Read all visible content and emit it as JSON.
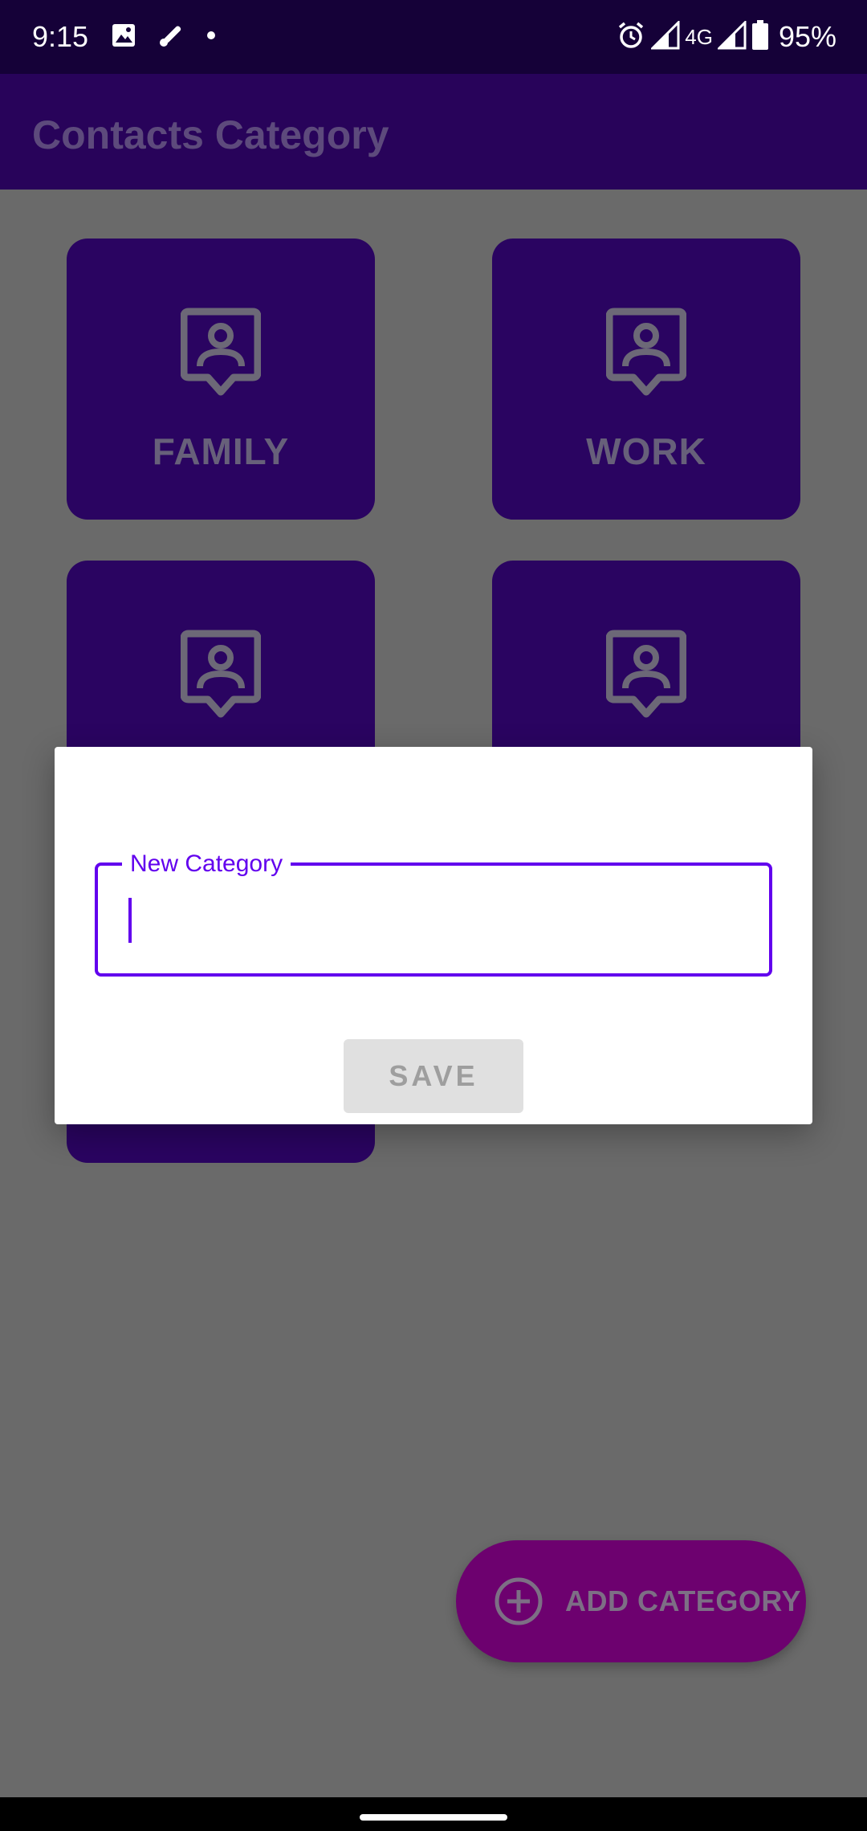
{
  "status_bar": {
    "time": "9:15",
    "network": "4G",
    "battery": "95%",
    "left_icons": [
      "image-icon",
      "brush-icon",
      "dot-icon"
    ],
    "right_icons": [
      "alarm-icon",
      "signal-icon",
      "signal-icon",
      "battery-icon"
    ]
  },
  "app_bar": {
    "title": "Contacts Category"
  },
  "categories": [
    {
      "label": "FAMILY",
      "icon": "contact-icon"
    },
    {
      "label": "WORK",
      "icon": "contact-icon"
    },
    {
      "label": "",
      "icon": "contact-icon"
    },
    {
      "label": "",
      "icon": "contact-icon"
    },
    {
      "label": "",
      "icon": ""
    }
  ],
  "dialog": {
    "field_label": "New Category",
    "field_value": "",
    "save_label": "SAVE"
  },
  "fab": {
    "label": "ADD CATEGORY",
    "icon": "add-circle-icon"
  },
  "colors": {
    "status_bar": "#150138",
    "app_bar": "#28035a",
    "card": "#2a0461",
    "accent": "#6200ee",
    "fab": "#6d016f",
    "scrim_background": "#6a6a6a"
  }
}
